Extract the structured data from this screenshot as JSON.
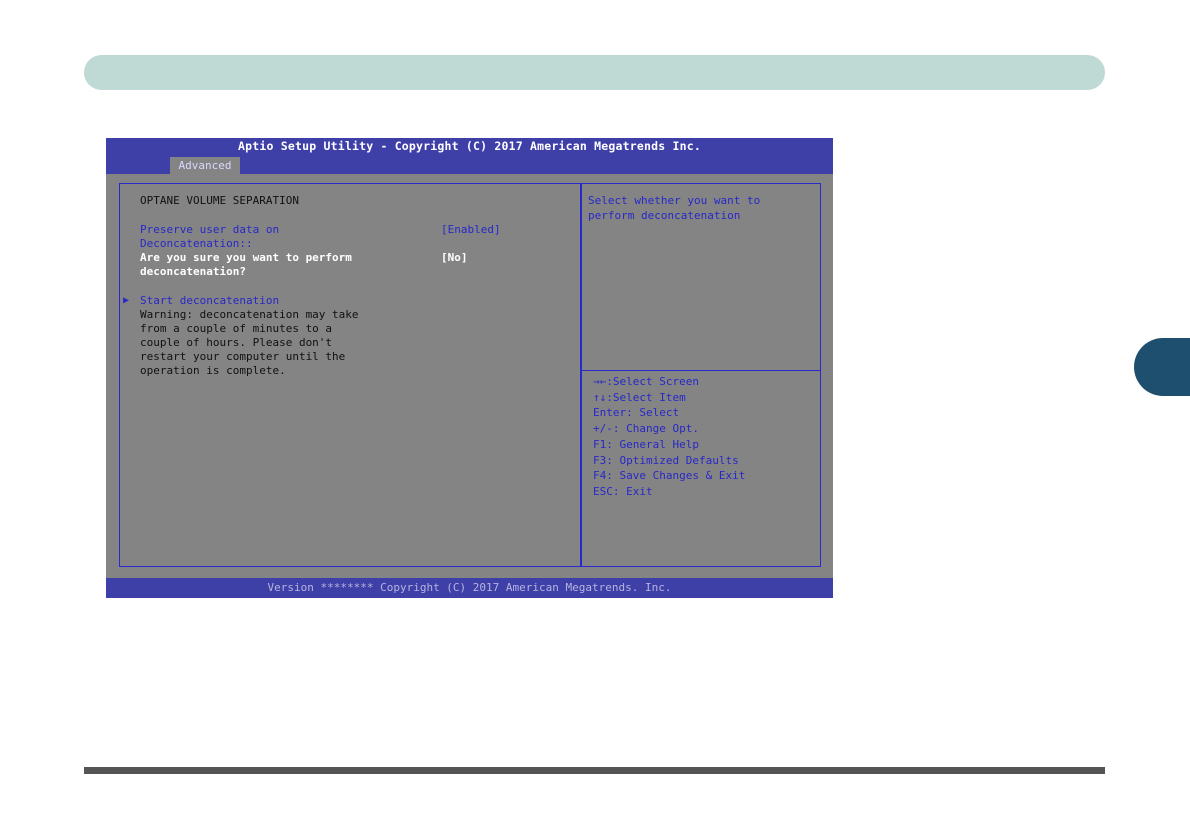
{
  "bios": {
    "title": "Aptio Setup Utility - Copyright (C) 2017 American Megatrends Inc.",
    "active_tab": "Advanced",
    "footer": "Version ******** Copyright (C) 2017 American Megatrends. Inc.",
    "section_title": "OPTANE VOLUME SEPARATION",
    "options": [
      {
        "label_line1": "Preserve user data on",
        "label_line2": "Deconcatenation::",
        "value": "[Enabled]"
      },
      {
        "label_line1": "Are you sure you want to perform",
        "label_line2": "deconcatenation?",
        "value": "[No]"
      }
    ],
    "action": "Start deconcatenation",
    "warning_lines": [
      "Warning: deconcatenation may take",
      "from a couple of minutes to a",
      "couple of hours. Please don't",
      "restart your computer until the",
      "operation is complete."
    ],
    "help_text_lines": [
      "Select whether you want to",
      "perform deconcatenation"
    ],
    "key_help": [
      "→←:Select Screen",
      "↑↓:Select Item",
      "Enter: Select",
      "+/-: Change Opt.",
      "F1: General Help",
      "F3: Optimized Defaults",
      "F4: Save Changes & Exit",
      "ESC: Exit"
    ]
  },
  "colors": {
    "title_bar": "#3f3fa8",
    "panel_bg": "#848484",
    "accent_blue": "#2828c8",
    "header_band": "#bfd9d5",
    "chapter_tab": "#1f4f6e"
  }
}
